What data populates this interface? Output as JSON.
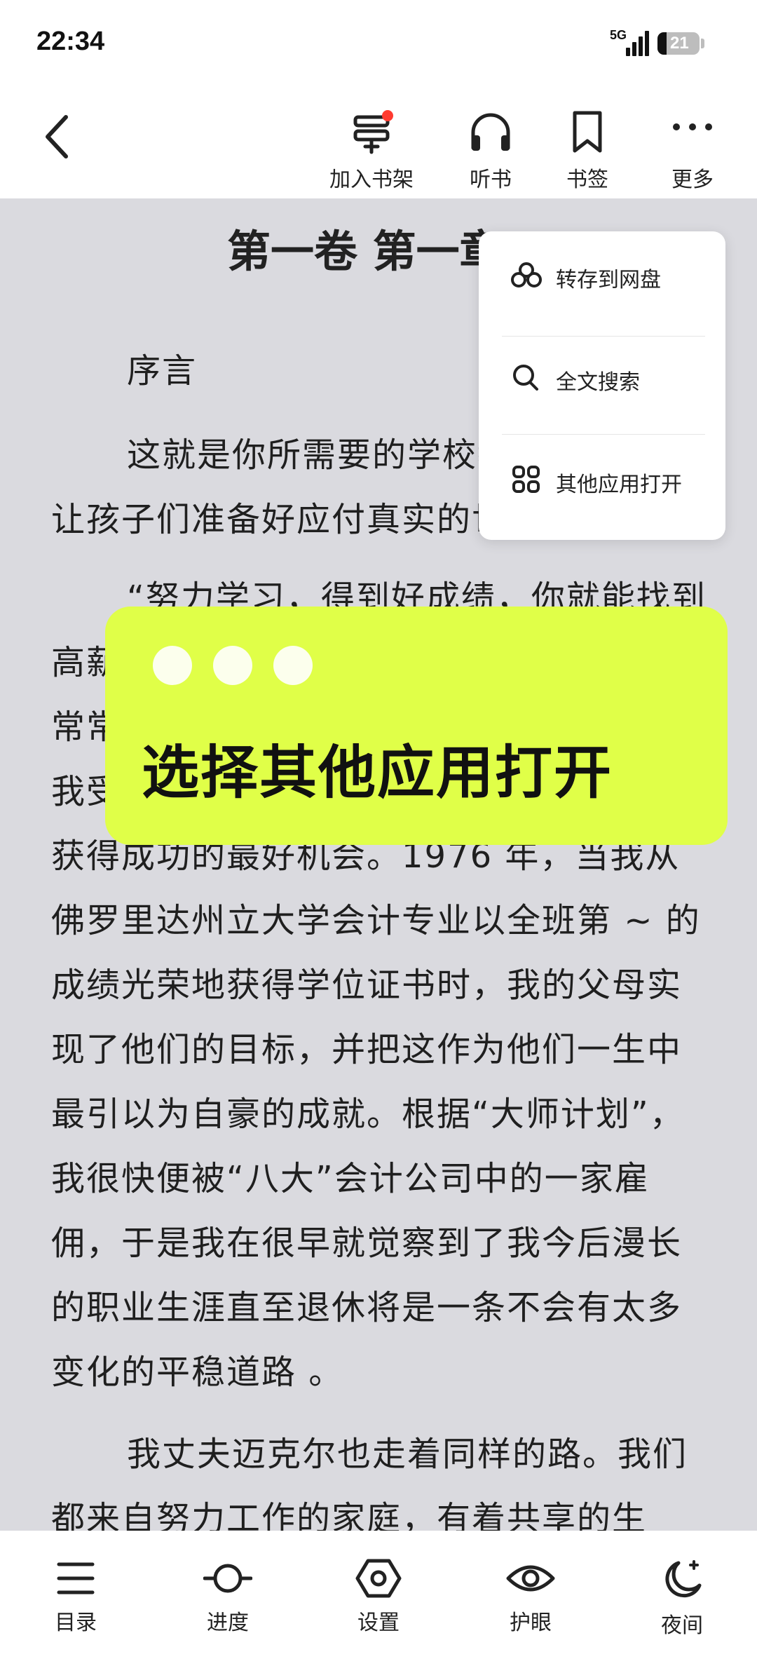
{
  "status_bar": {
    "time": "22:34",
    "network": "5G",
    "battery": "21",
    "battery_level": 0.21
  },
  "toolbar": {
    "add_to_shelf": "加入书架",
    "listen": "听书",
    "bookmark": "书签",
    "more": "更多"
  },
  "reader": {
    "chapter_title": "第一卷 第一章",
    "paragraphs": [
      "序言",
      "这就是你所需要的学校教育吗？它能让孩子们准备好应付真实的世界了吗？",
      "“努力学习，得到好成绩，你就能找到高薪、有着良好福利待遇的工作。”我父母常常这样对我说。他们人生的目标就是让我受到大学教育，这样我就有了在生活中获得成功的最好机会。1976 年，当我从佛罗里达州立大学会计专业以全班第 ~ 的成绩光荣地获得学位证书时，我的父母实现了他们的目标，并把这作为他们一生中最引以为自豪的成就。根据“大师计划”，我很快便被“八大”会计公司中的一家雇佣，于是我在很早就觉察到了我今后漫长的职业生涯直至退休将是一条不会有太多变化的平稳道路 。",
      "我丈夫迈克尔也走着同样的路。我们都来自努力工作的家庭，有着共享的生"
    ]
  },
  "menu": {
    "items": [
      {
        "label": "转存到网盘",
        "icon": "cloud-drive-icon"
      },
      {
        "label": "全文搜索",
        "icon": "search-icon"
      },
      {
        "label": "其他应用打开",
        "icon": "apps-grid-icon"
      }
    ]
  },
  "overlay": {
    "title": "选择其他应用打开"
  },
  "bottom_bar": {
    "contents": "目录",
    "progress": "进度",
    "settings": "设置",
    "eye_care": "护眼",
    "night": "夜间"
  }
}
